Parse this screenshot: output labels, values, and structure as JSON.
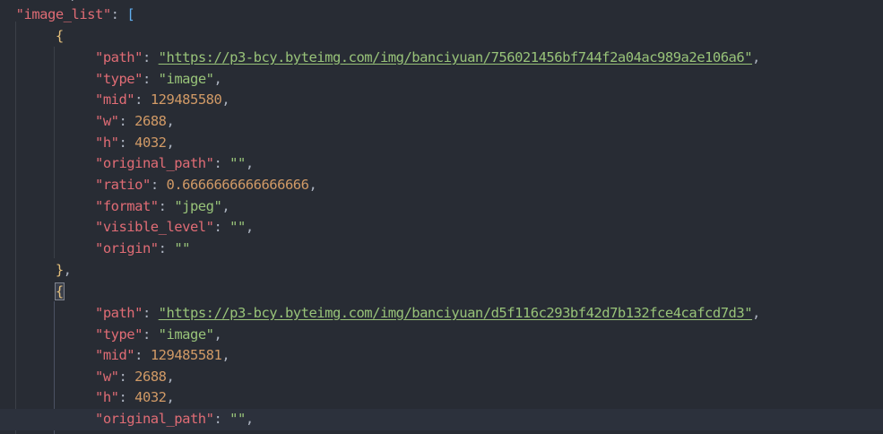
{
  "colors": {
    "background": "#282c34",
    "current_line": "#2c313c",
    "key": "#e06c75",
    "string": "#98c379",
    "number": "#d19a66",
    "punctuation": "#abb2bf",
    "brace_gold": "#e5c07b",
    "bracket_blue": "#61afef"
  },
  "code": {
    "top_fragment_key": "\"",
    "top_fragment_punct": "\"",
    "top_fragment_comma": ",",
    "list_key": "\"image_list\"",
    "colon": ": ",
    "open_bracket": "[",
    "open_brace": "{",
    "close_brace": "}",
    "comma": ",",
    "items": [
      {
        "path": {
          "key": "\"path\"",
          "value": "\"https://p3-bcy.byteimg.com/img/banciyuan/756021456bf744f2a04ac989a2e106a6\""
        },
        "type": {
          "key": "\"type\"",
          "value": "\"image\""
        },
        "mid": {
          "key": "\"mid\"",
          "value": "129485580"
        },
        "w": {
          "key": "\"w\"",
          "value": "2688"
        },
        "h": {
          "key": "\"h\"",
          "value": "4032"
        },
        "original_path": {
          "key": "\"original_path\"",
          "value": "\"\""
        },
        "ratio": {
          "key": "\"ratio\"",
          "value": "0.6666666666666666"
        },
        "format": {
          "key": "\"format\"",
          "value": "\"jpeg\""
        },
        "visible_level": {
          "key": "\"visible_level\"",
          "value": "\"\""
        },
        "origin": {
          "key": "\"origin\"",
          "value": "\"\""
        }
      },
      {
        "path": {
          "key": "\"path\"",
          "value": "\"https://p3-bcy.byteimg.com/img/banciyuan/d5f116c293bf42d7b132fce4cafcd7d3\""
        },
        "type": {
          "key": "\"type\"",
          "value": "\"image\""
        },
        "mid": {
          "key": "\"mid\"",
          "value": "129485581"
        },
        "w": {
          "key": "\"w\"",
          "value": "2688"
        },
        "h": {
          "key": "\"h\"",
          "value": "4032"
        },
        "original_path": {
          "key": "\"original_path\"",
          "value": "\"\""
        }
      }
    ]
  }
}
